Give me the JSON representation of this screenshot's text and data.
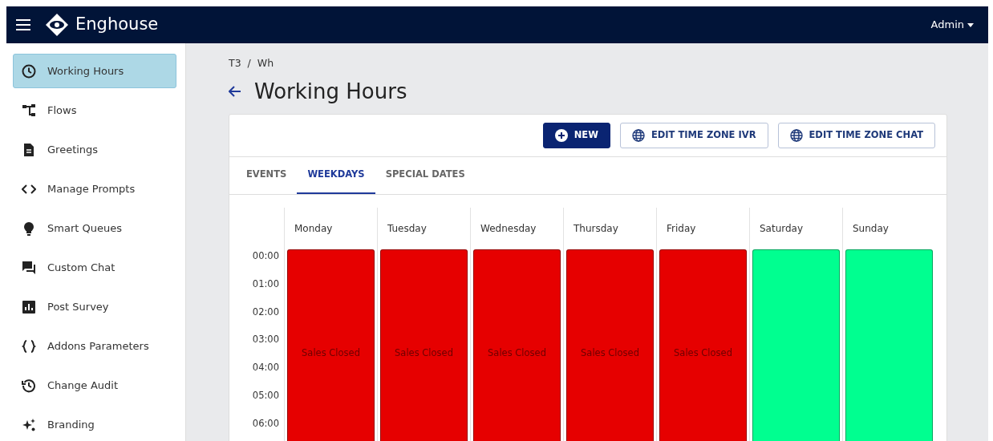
{
  "navbar": {
    "brand": "Enghouse",
    "user": "Admin"
  },
  "sidebar": {
    "items": [
      {
        "label": "Working Hours",
        "selected": true
      },
      {
        "label": "Flows",
        "selected": false
      },
      {
        "label": "Greetings",
        "selected": false
      },
      {
        "label": "Manage Prompts",
        "selected": false
      },
      {
        "label": "Smart Queues",
        "selected": false
      },
      {
        "label": "Custom Chat",
        "selected": false
      },
      {
        "label": "Post Survey",
        "selected": false
      },
      {
        "label": "Addons Parameters",
        "selected": false
      },
      {
        "label": "Change Audit",
        "selected": false
      },
      {
        "label": "Branding",
        "selected": false
      }
    ]
  },
  "breadcrumb": [
    "T3",
    "/",
    "Wh"
  ],
  "title": "Working Hours",
  "toolbar": [
    {
      "label": "NEW",
      "kind": "primary"
    },
    {
      "label": "EDIT TIME ZONE IVR",
      "kind": "outline"
    },
    {
      "label": "EDIT TIME ZONE CHAT",
      "kind": "outline"
    }
  ],
  "tabs": [
    {
      "label": "EVENTS",
      "selected": false
    },
    {
      "label": "WEEKDAYS",
      "selected": true
    },
    {
      "label": "SPECIAL DATES",
      "selected": false
    }
  ],
  "calendar": {
    "times": [
      "00:00",
      "01:00",
      "02:00",
      "03:00",
      "04:00",
      "05:00",
      "06:00"
    ],
    "days": [
      {
        "name": "Monday",
        "event": {
          "label": "Sales Closed",
          "color": "#e60000"
        }
      },
      {
        "name": "Tuesday",
        "event": {
          "label": "Sales Closed",
          "color": "#e60000"
        }
      },
      {
        "name": "Wednesday",
        "event": {
          "label": "Sales Closed",
          "color": "#e60000"
        }
      },
      {
        "name": "Thursday",
        "event": {
          "label": "Sales Closed",
          "color": "#e60000"
        }
      },
      {
        "name": "Friday",
        "event": {
          "label": "Sales Closed",
          "color": "#e60000"
        }
      },
      {
        "name": "Saturday",
        "event": {
          "color": "#00ff90"
        }
      },
      {
        "name": "Sunday",
        "event": {
          "color": "#00ff90"
        }
      }
    ]
  }
}
